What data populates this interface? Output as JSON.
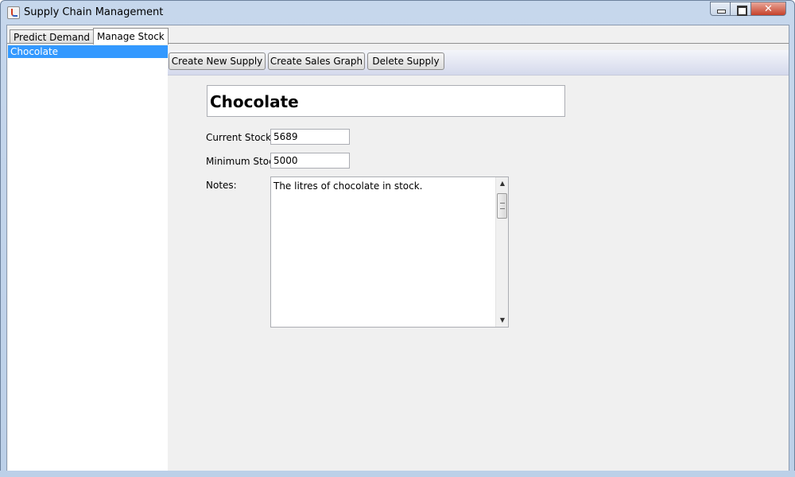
{
  "window": {
    "title": "Supply Chain Management"
  },
  "tabs": [
    {
      "label": "Predict Demand",
      "active": false
    },
    {
      "label": "Manage Stock",
      "active": true
    }
  ],
  "supply_list": {
    "items": [
      "Chocolate"
    ],
    "selected": "Chocolate"
  },
  "toolbar": {
    "create_new_supply": "Create New Supply",
    "create_sales_graph": "Create Sales Graph",
    "delete_supply": "Delete Supply"
  },
  "detail": {
    "name": "Chocolate",
    "current_stock_label": "Current Stock:",
    "current_stock": "5689",
    "minimum_stock_label": "Minimum Stock:",
    "minimum_stock": "5000",
    "notes_label": "Notes:",
    "notes": "The litres of chocolate in stock."
  },
  "colors": {
    "selection": "#3399ff",
    "titlebar": "#c6d7ec"
  }
}
